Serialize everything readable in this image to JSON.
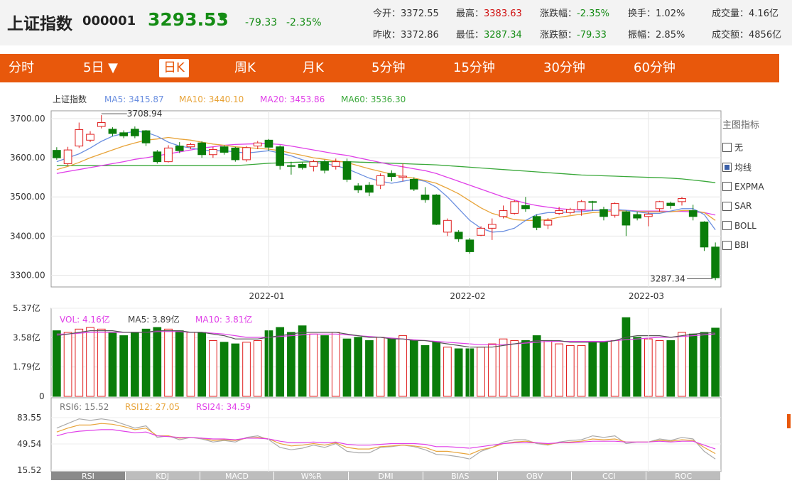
{
  "header": {
    "name": "上证指数",
    "code": "000001",
    "price": "3293.53",
    "arrow": "▼",
    "change": "-79.33",
    "change_pct": "-2.35%",
    "stats": [
      {
        "label": "今开：",
        "value": "3372.55",
        "tone": "normal"
      },
      {
        "label": "最高：",
        "value": "3383.63",
        "tone": "red"
      },
      {
        "label": "涨跌幅：",
        "value": "-2.35%",
        "tone": "green"
      },
      {
        "label": "换手：",
        "value": "1.02%",
        "tone": "normal"
      },
      {
        "label": "成交量：",
        "value": "4.16亿",
        "tone": "normal"
      },
      {
        "label": "昨收：",
        "value": "3372.86",
        "tone": "normal"
      },
      {
        "label": "最低：",
        "value": "3287.34",
        "tone": "green"
      },
      {
        "label": "涨跌额：",
        "value": "-79.33",
        "tone": "green"
      },
      {
        "label": "振幅：",
        "value": "2.85%",
        "tone": "normal"
      },
      {
        "label": "成交额：",
        "value": "4856亿",
        "tone": "normal"
      }
    ]
  },
  "tabs": [
    {
      "label": "分时",
      "active": false
    },
    {
      "label": "5日 ▼",
      "active": false
    },
    {
      "label": "日K",
      "active": true
    },
    {
      "label": "周K",
      "active": false
    },
    {
      "label": "月K",
      "active": false
    },
    {
      "label": "5分钟",
      "active": false
    },
    {
      "label": "15分钟",
      "active": false
    },
    {
      "label": "30分钟",
      "active": false
    },
    {
      "label": "60分钟",
      "active": false
    }
  ],
  "legend_main": {
    "name": "上证指数",
    "ma5": "MA5: 3415.87",
    "ma10": "MA10: 3440.10",
    "ma20": "MA20: 3453.86",
    "ma60": "MA60: 3536.30"
  },
  "legend_vol": {
    "vol": "VOL: 4.16亿",
    "ma5": "MA5: 3.89亿",
    "ma10": "MA10: 3.81亿"
  },
  "legend_rsi": {
    "rsi6": "RSI6: 15.52",
    "rsi12": "RSI12: 27.05",
    "rsi24": "RSI24: 34.59"
  },
  "annotations": {
    "high": "3708.94",
    "low": "3287.34"
  },
  "indicator_panel": {
    "title": "主图指标",
    "items": [
      {
        "label": "无",
        "checked": false
      },
      {
        "label": "均线",
        "checked": true
      },
      {
        "label": "EXPMA",
        "checked": false
      },
      {
        "label": "SAR",
        "checked": false
      },
      {
        "label": "BOLL",
        "checked": false
      },
      {
        "label": "BBI",
        "checked": false
      }
    ]
  },
  "bottom_tabs": [
    {
      "label": "RSI",
      "active": true
    },
    {
      "label": "KDJ",
      "active": false
    },
    {
      "label": "MACD",
      "active": false
    },
    {
      "label": "W%R",
      "active": false
    },
    {
      "label": "DMI",
      "active": false
    },
    {
      "label": "BIAS",
      "active": false
    },
    {
      "label": "OBV",
      "active": false
    },
    {
      "label": "CCI",
      "active": false
    },
    {
      "label": "ROC",
      "active": false
    }
  ],
  "colors": {
    "up": "#e02020",
    "down": "#0a7d0a",
    "ma5": "#6b8fe0",
    "ma10": "#e8a43a",
    "ma20": "#e040e8",
    "ma60": "#3aa83a",
    "accent": "#e8580c"
  },
  "chart_data": [
    {
      "type": "candlestick",
      "ylim": [
        3270,
        3720
      ],
      "yticks": [
        "3700.00",
        "3600.00",
        "3500.00",
        "3400.00",
        "3300.00"
      ],
      "ytick_values": [
        3700,
        3600,
        3500,
        3400,
        3300
      ],
      "xticks": [
        {
          "label": "2022-01",
          "at": 19
        },
        {
          "label": "2022-02",
          "at": 37
        },
        {
          "label": "2022-03",
          "at": 53
        }
      ],
      "candles": [
        [
          3619,
          3600,
          3627,
          3595
        ],
        [
          3585,
          3620,
          3628,
          3580
        ],
        [
          3630,
          3672,
          3690,
          3625
        ],
        [
          3645,
          3660,
          3668,
          3640
        ],
        [
          3680,
          3690,
          3708.94,
          3675
        ],
        [
          3673,
          3662,
          3678,
          3655
        ],
        [
          3664,
          3656,
          3670,
          3650
        ],
        [
          3673,
          3656,
          3680,
          3650
        ],
        [
          3669,
          3638,
          3671,
          3630
        ],
        [
          3615,
          3590,
          3620,
          3585
        ],
        [
          3590,
          3625,
          3632,
          3588
        ],
        [
          3630,
          3618,
          3640,
          3612
        ],
        [
          3628,
          3634,
          3638,
          3622
        ],
        [
          3638,
          3608,
          3642,
          3600
        ],
        [
          3608,
          3621,
          3628,
          3600
        ],
        [
          3628,
          3614,
          3632,
          3608
        ],
        [
          3625,
          3595,
          3628,
          3590
        ],
        [
          3595,
          3626,
          3630,
          3590
        ],
        [
          3630,
          3638,
          3643,
          3622
        ],
        [
          3645,
          3627,
          3648,
          3618
        ],
        [
          3628,
          3580,
          3632,
          3570
        ],
        [
          3580,
          3578,
          3590,
          3557
        ],
        [
          3583,
          3575,
          3588,
          3570
        ],
        [
          3578,
          3590,
          3595,
          3565
        ],
        [
          3590,
          3568,
          3595,
          3560
        ],
        [
          3578,
          3590,
          3598,
          3570
        ],
        [
          3590,
          3545,
          3598,
          3538
        ],
        [
          3528,
          3518,
          3535,
          3510
        ],
        [
          3530,
          3512,
          3538,
          3502
        ],
        [
          3530,
          3554,
          3560,
          3520
        ],
        [
          3560,
          3552,
          3568,
          3540
        ],
        [
          3550,
          3553,
          3585,
          3540
        ],
        [
          3545,
          3520,
          3550,
          3515
        ],
        [
          3505,
          3493,
          3525,
          3485
        ],
        [
          3505,
          3430,
          3507,
          3428
        ],
        [
          3410,
          3440,
          3445,
          3400
        ],
        [
          3410,
          3393,
          3415,
          3385
        ],
        [
          3390,
          3360,
          3395,
          3355
        ],
        [
          3402,
          3420,
          3425,
          3400
        ],
        [
          3420,
          3430,
          3445,
          3390
        ],
        [
          3450,
          3465,
          3478,
          3445
        ],
        [
          3458,
          3488,
          3492,
          3455
        ],
        [
          3478,
          3470,
          3500,
          3462
        ],
        [
          3450,
          3422,
          3455,
          3415
        ],
        [
          3428,
          3440,
          3446,
          3418
        ],
        [
          3458,
          3465,
          3475,
          3454
        ],
        [
          3460,
          3468,
          3472,
          3455
        ],
        [
          3468,
          3488,
          3492,
          3452
        ],
        [
          3488,
          3486,
          3490,
          3465
        ],
        [
          3468,
          3450,
          3475,
          3440
        ],
        [
          3453,
          3483,
          3486,
          3447
        ],
        [
          3462,
          3428,
          3465,
          3400
        ],
        [
          3455,
          3446,
          3462,
          3440
        ],
        [
          3450,
          3456,
          3462,
          3425
        ],
        [
          3470,
          3488,
          3490,
          3462
        ],
        [
          3484,
          3478,
          3488,
          3470
        ],
        [
          3488,
          3496,
          3500,
          3478
        ],
        [
          3465,
          3450,
          3480,
          3440
        ],
        [
          3436,
          3372,
          3438,
          3362
        ],
        [
          3372,
          3293.53,
          3383.63,
          3287.34
        ]
      ],
      "ma5": [
        3590,
        3600,
        3610,
        3625,
        3642,
        3655,
        3662,
        3668,
        3665,
        3655,
        3640,
        3630,
        3625,
        3620,
        3618,
        3618,
        3615,
        3612,
        3615,
        3618,
        3612,
        3605,
        3595,
        3588,
        3585,
        3580,
        3572,
        3560,
        3548,
        3540,
        3535,
        3540,
        3545,
        3540,
        3525,
        3500,
        3470,
        3440,
        3420,
        3410,
        3412,
        3420,
        3440,
        3455,
        3460,
        3460,
        3462,
        3462,
        3465,
        3466,
        3468,
        3466,
        3462,
        3458,
        3458,
        3464,
        3470,
        3470,
        3455,
        3415.87
      ],
      "ma10": [
        3570,
        3578,
        3588,
        3600,
        3610,
        3620,
        3630,
        3638,
        3645,
        3648,
        3652,
        3648,
        3645,
        3640,
        3635,
        3632,
        3628,
        3626,
        3624,
        3622,
        3618,
        3612,
        3606,
        3600,
        3596,
        3592,
        3588,
        3580,
        3572,
        3565,
        3558,
        3552,
        3548,
        3542,
        3535,
        3522,
        3508,
        3490,
        3472,
        3458,
        3450,
        3442,
        3440,
        3440,
        3442,
        3448,
        3452,
        3456,
        3460,
        3462,
        3464,
        3465,
        3463,
        3462,
        3462,
        3462,
        3465,
        3465,
        3460,
        3440.1
      ],
      "ma20": [
        3560,
        3565,
        3570,
        3575,
        3580,
        3585,
        3590,
        3596,
        3600,
        3605,
        3610,
        3615,
        3620,
        3625,
        3628,
        3632,
        3634,
        3635,
        3636,
        3636,
        3634,
        3630,
        3625,
        3620,
        3615,
        3610,
        3606,
        3600,
        3594,
        3588,
        3582,
        3577,
        3572,
        3567,
        3560,
        3550,
        3540,
        3530,
        3520,
        3510,
        3500,
        3492,
        3484,
        3478,
        3474,
        3470,
        3468,
        3466,
        3466,
        3466,
        3466,
        3466,
        3464,
        3464,
        3464,
        3463,
        3463,
        3462,
        3460,
        3453.86
      ],
      "ma60": [
        3580,
        3580,
        3580,
        3580,
        3580,
        3580,
        3580,
        3580,
        3580,
        3580,
        3580,
        3580,
        3580,
        3580,
        3580,
        3580,
        3580,
        3582,
        3584,
        3586,
        3587,
        3588,
        3589,
        3590,
        3590,
        3590,
        3590,
        3589,
        3588,
        3587,
        3586,
        3585,
        3584,
        3583,
        3582,
        3580,
        3578,
        3576,
        3574,
        3572,
        3570,
        3568,
        3566,
        3564,
        3562,
        3560,
        3558,
        3556,
        3555,
        3554,
        3553,
        3552,
        3551,
        3550,
        3549,
        3548,
        3546,
        3543,
        3540,
        3536.3
      ]
    },
    {
      "type": "bar",
      "title": "VOL",
      "ylim": [
        0,
        5.37
      ],
      "yticks": [
        "5.37亿",
        "3.58亿",
        "1.79亿",
        "0"
      ],
      "ytick_values": [
        5.37,
        3.58,
        1.79,
        0
      ],
      "values": [
        4.0,
        3.9,
        4.1,
        4.2,
        4.1,
        3.9,
        3.7,
        3.9,
        4.1,
        4.2,
        4.1,
        4.0,
        3.9,
        3.9,
        3.4,
        3.3,
        3.2,
        3.3,
        3.4,
        4.0,
        4.2,
        3.9,
        4.3,
        3.8,
        3.7,
        3.9,
        3.5,
        3.6,
        3.4,
        3.6,
        3.5,
        3.7,
        3.4,
        3.1,
        3.3,
        3.0,
        2.9,
        2.9,
        3.0,
        3.2,
        3.5,
        3.4,
        3.4,
        3.7,
        3.4,
        3.2,
        3.1,
        3.1,
        3.3,
        3.3,
        3.4,
        4.8,
        3.6,
        3.5,
        3.4,
        3.4,
        3.9,
        3.8,
        3.9,
        4.16
      ],
      "ma5": [
        3.7,
        3.8,
        3.9,
        4.0,
        4.0,
        4.0,
        3.9,
        3.9,
        3.9,
        4.0,
        4.0,
        4.0,
        3.9,
        3.9,
        3.8,
        3.7,
        3.5,
        3.5,
        3.5,
        3.6,
        3.7,
        3.8,
        3.9,
        3.9,
        3.9,
        3.9,
        3.8,
        3.7,
        3.6,
        3.6,
        3.5,
        3.5,
        3.4,
        3.4,
        3.3,
        3.2,
        3.1,
        3.0,
        3.0,
        3.0,
        3.1,
        3.2,
        3.3,
        3.4,
        3.4,
        3.4,
        3.3,
        3.3,
        3.3,
        3.3,
        3.4,
        3.6,
        3.7,
        3.7,
        3.7,
        3.6,
        3.7,
        3.8,
        3.85,
        3.89
      ],
      "ma10": [
        3.8,
        3.8,
        3.85,
        3.9,
        3.9,
        3.9,
        3.9,
        3.9,
        3.9,
        3.95,
        3.95,
        3.95,
        3.9,
        3.9,
        3.85,
        3.8,
        3.7,
        3.6,
        3.6,
        3.6,
        3.65,
        3.7,
        3.75,
        3.8,
        3.8,
        3.8,
        3.75,
        3.7,
        3.65,
        3.6,
        3.55,
        3.5,
        3.45,
        3.4,
        3.35,
        3.3,
        3.25,
        3.2,
        3.15,
        3.15,
        3.15,
        3.2,
        3.25,
        3.3,
        3.35,
        3.35,
        3.35,
        3.35,
        3.35,
        3.35,
        3.4,
        3.45,
        3.5,
        3.55,
        3.6,
        3.6,
        3.65,
        3.7,
        3.75,
        3.81
      ]
    },
    {
      "type": "line",
      "title": "RSI",
      "ylim": [
        15.52,
        83.55
      ],
      "yticks": [
        "83.55",
        "49.54",
        "15.52"
      ],
      "ytick_values": [
        83.55,
        49.54,
        15.52
      ],
      "series": [
        {
          "name": "RSI6",
          "values": [
            70,
            76,
            82,
            80,
            82,
            80,
            75,
            70,
            73,
            58,
            60,
            55,
            58,
            56,
            52,
            54,
            52,
            58,
            60,
            55,
            45,
            42,
            44,
            48,
            45,
            50,
            40,
            38,
            38,
            45,
            46,
            48,
            46,
            42,
            36,
            35,
            33,
            30,
            40,
            45,
            52,
            55,
            55,
            50,
            48,
            52,
            54,
            55,
            60,
            58,
            60,
            50,
            52,
            52,
            56,
            54,
            58,
            56,
            40,
            30
          ]
        },
        {
          "name": "RSI12",
          "values": [
            65,
            70,
            74,
            74,
            76,
            75,
            72,
            68,
            70,
            60,
            60,
            57,
            58,
            57,
            54,
            55,
            54,
            57,
            58,
            56,
            50,
            47,
            48,
            50,
            48,
            51,
            45,
            43,
            43,
            46,
            47,
            48,
            47,
            45,
            40,
            40,
            38,
            36,
            42,
            45,
            50,
            52,
            53,
            51,
            49,
            51,
            52,
            53,
            56,
            55,
            56,
            52,
            52,
            52,
            54,
            53,
            55,
            54,
            45,
            37
          ]
        },
        {
          "name": "RSI24",
          "values": [
            60,
            64,
            66,
            67,
            68,
            68,
            66,
            64,
            65,
            60,
            59,
            58,
            58,
            57,
            56,
            56,
            55,
            57,
            57,
            56,
            53,
            51,
            51,
            52,
            51,
            52,
            49,
            48,
            48,
            49,
            50,
            50,
            50,
            49,
            46,
            46,
            45,
            44,
            46,
            48,
            50,
            51,
            51,
            51,
            50,
            51,
            51,
            52,
            53,
            53,
            53,
            52,
            52,
            52,
            53,
            52,
            53,
            53,
            48,
            43
          ]
        }
      ]
    }
  ]
}
